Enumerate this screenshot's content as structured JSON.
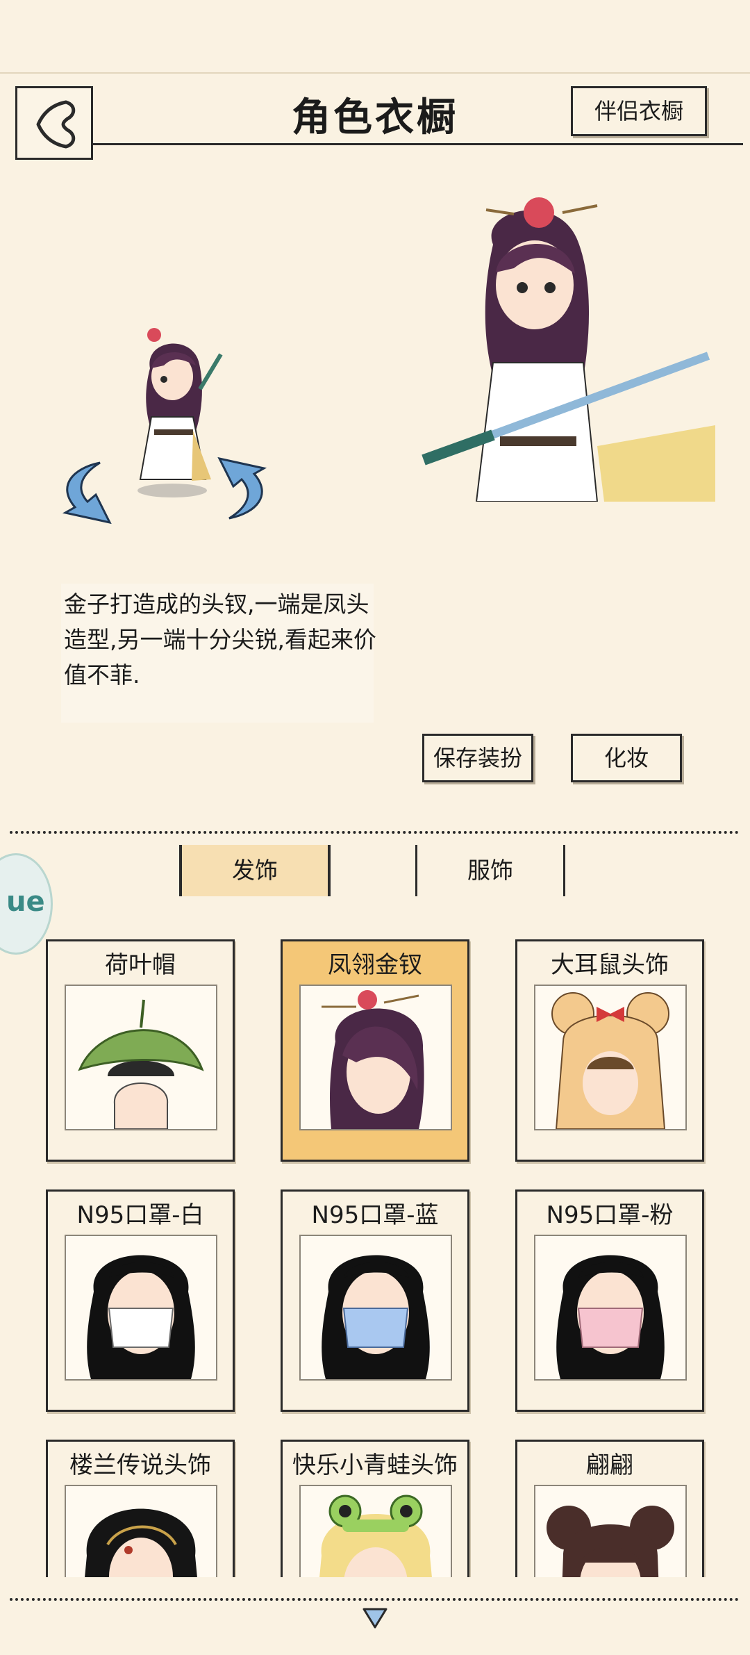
{
  "header": {
    "title": "角色衣橱",
    "companion_wardrobe": "伴侣衣橱"
  },
  "description": "金子打造成的头钗,一端是凤头造型,另一端十分尖锐,看起来价值不菲.",
  "actions": {
    "save": "保存装扮",
    "makeup": "化妆"
  },
  "tabs": [
    {
      "label": "发饰",
      "active": true
    },
    {
      "label": "服饰",
      "active": false
    }
  ],
  "side_badge": "ue",
  "items": [
    {
      "label": "荷叶帽",
      "selected": false,
      "icon": "lotus-leaf-hat"
    },
    {
      "label": "凤翎金钗",
      "selected": true,
      "icon": "phoenix-gold-hairpin"
    },
    {
      "label": "大耳鼠头饰",
      "selected": false,
      "icon": "big-ear-mouse-headwear"
    },
    {
      "label": "N95口罩-白",
      "selected": false,
      "icon": "mask-white"
    },
    {
      "label": "N95口罩-蓝",
      "selected": false,
      "icon": "mask-blue"
    },
    {
      "label": "N95口罩-粉",
      "selected": false,
      "icon": "mask-pink"
    },
    {
      "label": "楼兰传说头饰",
      "selected": false,
      "icon": "loulan-headwear"
    },
    {
      "label": "快乐小青蛙头饰",
      "selected": false,
      "icon": "frog-headwear"
    },
    {
      "label": "翩翩",
      "selected": false,
      "icon": "bun-hairstyle"
    }
  ],
  "colors": {
    "background": "#faf2e2",
    "selected_card": "#f4c777",
    "active_tab": "#f7dfb2",
    "ink": "#2a2a2a"
  }
}
